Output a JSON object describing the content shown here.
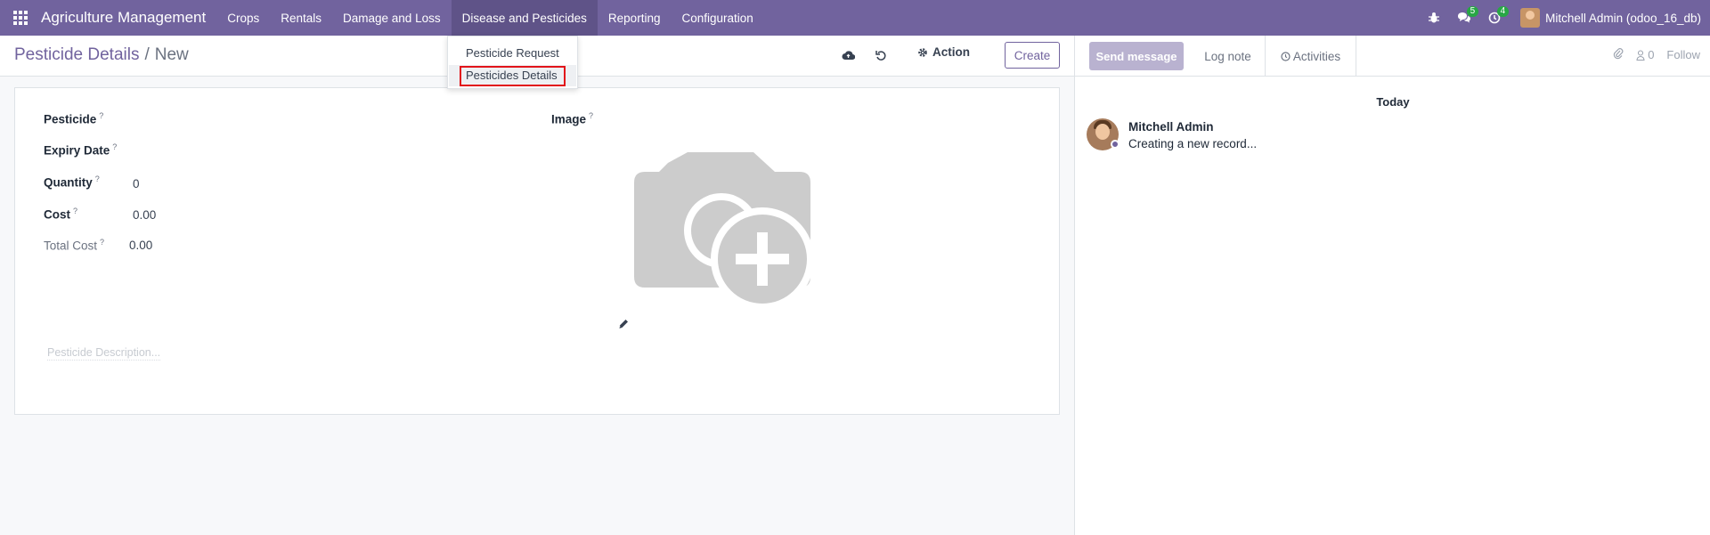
{
  "navbar": {
    "brand": "Agriculture Management",
    "menu": [
      {
        "label": "Crops"
      },
      {
        "label": "Rentals"
      },
      {
        "label": "Damage and Loss"
      },
      {
        "label": "Disease and Pesticides"
      },
      {
        "label": "Reporting"
      },
      {
        "label": "Configuration"
      }
    ],
    "messages_count": "5",
    "activities_count": "4",
    "user": "Mitchell Admin (odoo_16_db)"
  },
  "dropdown": {
    "items": [
      "Pesticide Request",
      "Pesticides Details"
    ]
  },
  "control_panel": {
    "breadcrumb_parent": "Pesticide Details",
    "breadcrumb_sep": "/",
    "breadcrumb_current": "New",
    "action_label": "Action",
    "create_label": "Create"
  },
  "form": {
    "pesticide_label": "Pesticide",
    "expiry_label": "Expiry Date",
    "quantity_label": "Quantity",
    "quantity_value": "0",
    "cost_label": "Cost",
    "cost_value": "0.00",
    "total_cost_label": "Total Cost",
    "total_cost_value": "0.00",
    "image_label": "Image",
    "help_mark": "?",
    "description_placeholder": "Pesticide Description..."
  },
  "chatter": {
    "send_message": "Send message",
    "log_note": "Log note",
    "activities": "Activities",
    "followers_count": "0",
    "follow": "Follow",
    "date_separator": "Today",
    "message_author": "Mitchell Admin",
    "message_body": "Creating a new record..."
  }
}
